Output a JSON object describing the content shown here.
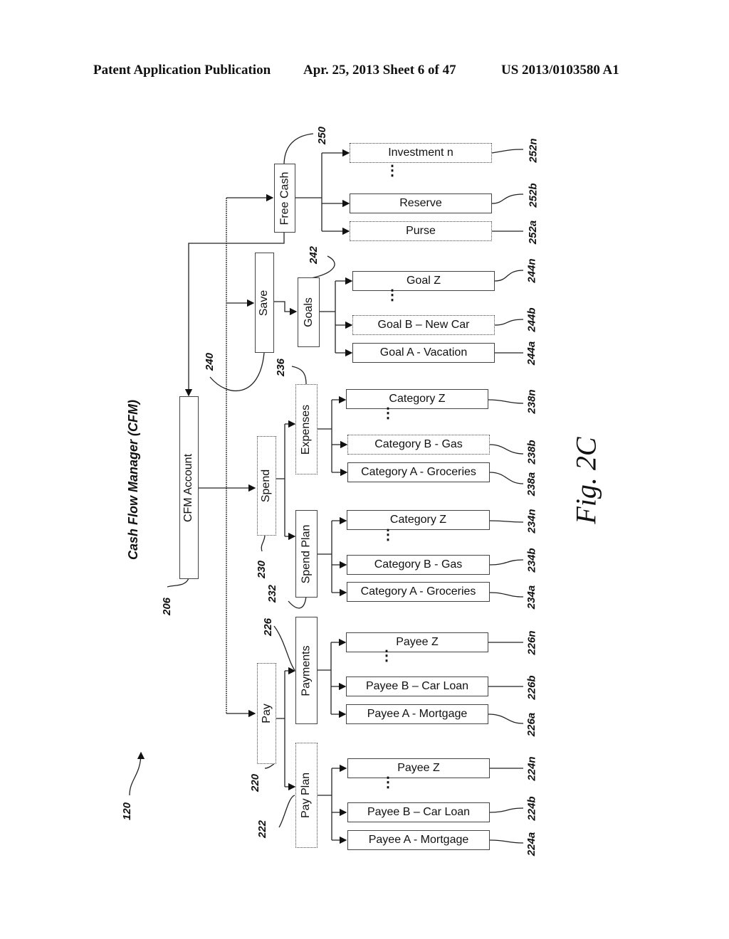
{
  "header": {
    "left": "Patent Application Publication",
    "middle": "Apr. 25, 2013  Sheet 6 of 47",
    "right": "US 2013/0103580 A1"
  },
  "diagram": {
    "title": "Cash Flow Manager (CFM)",
    "figure_label": "Fig. 2C",
    "system_ref": "120",
    "cfm_account": {
      "label": "CFM Account",
      "ref": "206"
    },
    "free_cash": {
      "label": "Free Cash",
      "ref": "250",
      "items": [
        {
          "label": "Investment n",
          "ref": "252n"
        },
        {
          "label": "Reserve",
          "ref": "252b"
        },
        {
          "label": "Purse",
          "ref": "252a"
        }
      ]
    },
    "save": {
      "label": "Save",
      "ref": "240",
      "goals": {
        "label": "Goals",
        "ref": "242",
        "items": [
          {
            "label": "Goal Z",
            "ref": "244n"
          },
          {
            "label": "Goal B – New Car",
            "ref": "244b"
          },
          {
            "label": "Goal A - Vacation",
            "ref": "244a"
          }
        ]
      }
    },
    "spend": {
      "label": "Spend",
      "ref": "230",
      "expenses": {
        "label": "Expenses",
        "ref": "236",
        "items": [
          {
            "label": "Category Z",
            "ref": "238n"
          },
          {
            "label": "Category B - Gas",
            "ref": "238b"
          },
          {
            "label": "Category A - Groceries",
            "ref": "238a"
          }
        ]
      },
      "spend_plan": {
        "label": "Spend Plan",
        "ref": "232",
        "items": [
          {
            "label": "Category Z",
            "ref": "234n"
          },
          {
            "label": "Category B - Gas",
            "ref": "234b"
          },
          {
            "label": "Category A - Groceries",
            "ref": "234a"
          }
        ]
      }
    },
    "pay": {
      "label": "Pay",
      "ref": "220",
      "payments": {
        "label": "Payments",
        "ref": "226",
        "items": [
          {
            "label": "Payee Z",
            "ref": "226n"
          },
          {
            "label": "Payee B – Car Loan",
            "ref": "226b"
          },
          {
            "label": "Payee A - Mortgage",
            "ref": "226a"
          }
        ]
      },
      "pay_plan": {
        "label": "Pay Plan",
        "ref": "222",
        "items": [
          {
            "label": "Payee Z",
            "ref": "224n"
          },
          {
            "label": "Payee B – Car Loan",
            "ref": "224b"
          },
          {
            "label": "Payee A - Mortgage",
            "ref": "224a"
          }
        ]
      }
    },
    "ellipsis": "⋮"
  }
}
